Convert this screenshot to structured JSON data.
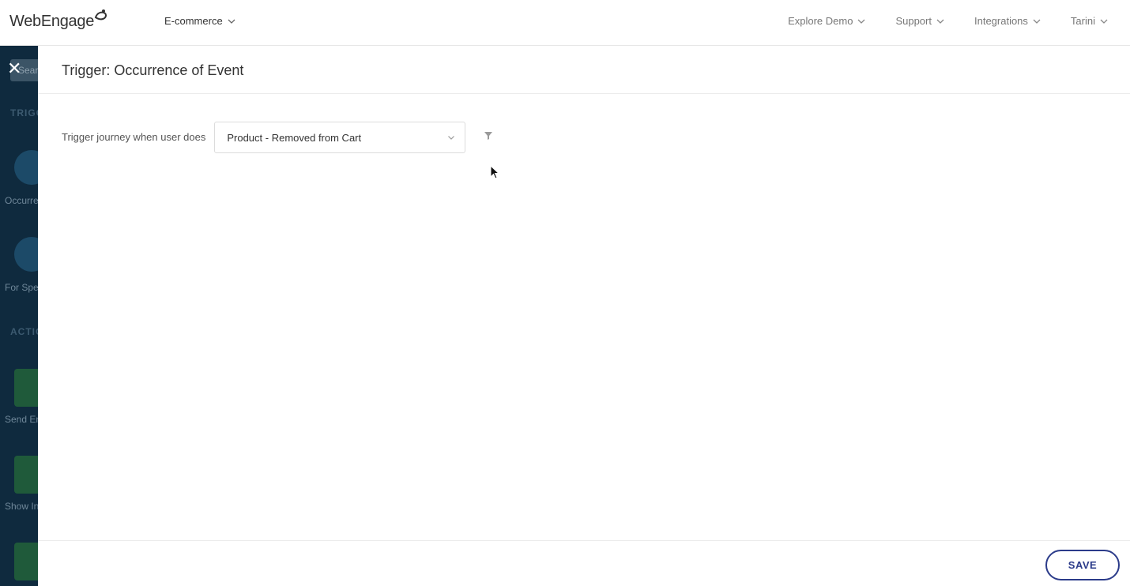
{
  "header": {
    "logo_text": "WebEngage",
    "project": "E-commerce",
    "nav": [
      "Explore Demo",
      "Support",
      "Integrations",
      "Tarini"
    ]
  },
  "sidebar": {
    "search_placeholder": "Search",
    "close_symbol": "✕",
    "sections": [
      "TRIGGERS",
      "ACTIONS"
    ],
    "items": [
      "Occurrence of Event",
      "For Specific Users",
      "Send Email",
      "Show In-App"
    ]
  },
  "panel": {
    "title": "Trigger: Occurrence of Event",
    "trigger_label": "Trigger journey when user does",
    "event_value": "Product - Removed from Cart",
    "save_label": "SAVE"
  },
  "colors": {
    "sidebar_bg": "#0f2a3e",
    "save_accent": "#2b3b8a"
  }
}
